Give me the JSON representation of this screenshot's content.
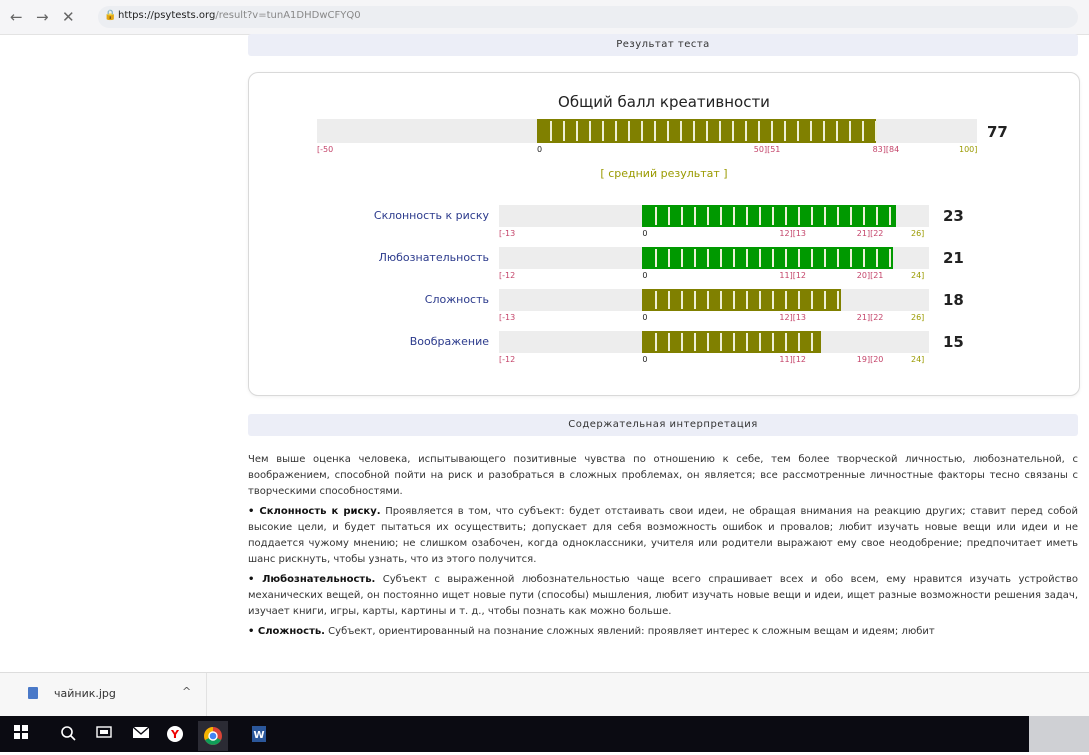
{
  "browser": {
    "back": "←",
    "forward": "→",
    "close": "✕",
    "url_host": "https://psytests.org",
    "url_rest": "/result?v=tunA1DHDwCFYQ0"
  },
  "sections": {
    "result_title": "Результат теста",
    "interpretation_title": "Содержательная интерпретация"
  },
  "chart": {
    "title": "Общий балл креативности",
    "avg_label": "[ средний результат ]",
    "total": {
      "score": "77",
      "min": -50,
      "max": 100,
      "value": 77,
      "fill_color": "#808000",
      "ticks": [
        "[-50",
        "0",
        "50][51",
        "83][84",
        "100]"
      ]
    },
    "rows": [
      {
        "label": "Склонность к риску",
        "score": "23",
        "min": -13,
        "max": 26,
        "value": 23,
        "fill_color": "#009900",
        "ticks": [
          "[-13",
          "0",
          "12][13",
          "21][22",
          "26]"
        ]
      },
      {
        "label": "Любознательность",
        "score": "21",
        "min": -12,
        "max": 24,
        "value": 21,
        "fill_color": "#009900",
        "ticks": [
          "[-12",
          "0",
          "11][12",
          "20][21",
          "24]"
        ]
      },
      {
        "label": "Сложность",
        "score": "18",
        "min": -13,
        "max": 26,
        "value": 18,
        "fill_color": "#808000",
        "ticks": [
          "[-13",
          "0",
          "12][13",
          "21][22",
          "26]"
        ]
      },
      {
        "label": "Воображение",
        "score": "15",
        "min": -12,
        "max": 24,
        "value": 15,
        "fill_color": "#808000",
        "ticks": [
          "[-12",
          "0",
          "11][12",
          "19][20",
          "24]"
        ]
      }
    ]
  },
  "interpretation": {
    "intro": "Чем выше оценка человека, испытывающего позитивные чувства по отношению к себе, тем более творческой личностью, любознательной, с воображением, способной пойти на риск и разобраться в сложных проблемах, он является; все рассмотренные личностные факторы тесно связаны с творческими способностями.",
    "items": [
      {
        "term": "• Склонность к риску.",
        "text": " Проявляется в том, что субъект: будет отстаивать свои идеи, не обращая внимания на реакцию других; ставит перед собой высокие цели, и будет пытаться их осуществить; допускает для себя возможность ошибок и провалов; любит изучать новые вещи или идеи и не поддается чужому мнению; не слишком озабочен, когда одноклассники, учителя или родители выражают ему свое неодобрение; предпочитает иметь шанс рискнуть, чтобы узнать, что из этого получится."
      },
      {
        "term": "• Любознательность.",
        "text": " Субъект с выраженной любознательностью чаще всего спрашивает всех и обо всем, ему нравится изучать устройство механических вещей, он постоянно ищет новые пути (способы) мышления, любит изучать новые вещи и идеи, ищет разные возможности решения задач, изучает книги, игры, карты, картины и т. д., чтобы познать как можно больше."
      },
      {
        "term": "• Сложность.",
        "text": " Субъект, ориентированный на познание сложных явлений: проявляет интерес к сложным вещам и идеям; любит"
      }
    ]
  },
  "download": {
    "filename": "чайник.jpg",
    "chevron": "^"
  },
  "taskbar": {
    "icons": [
      "windows-icon",
      "search-icon",
      "task-view-icon",
      "mail-icon",
      "yandex-browser-icon",
      "chrome-icon",
      "word-icon"
    ]
  },
  "colors": {
    "olive": "#808000",
    "green": "#009900",
    "red_ticks": "#c4446a",
    "link": "#2b3a8c"
  }
}
